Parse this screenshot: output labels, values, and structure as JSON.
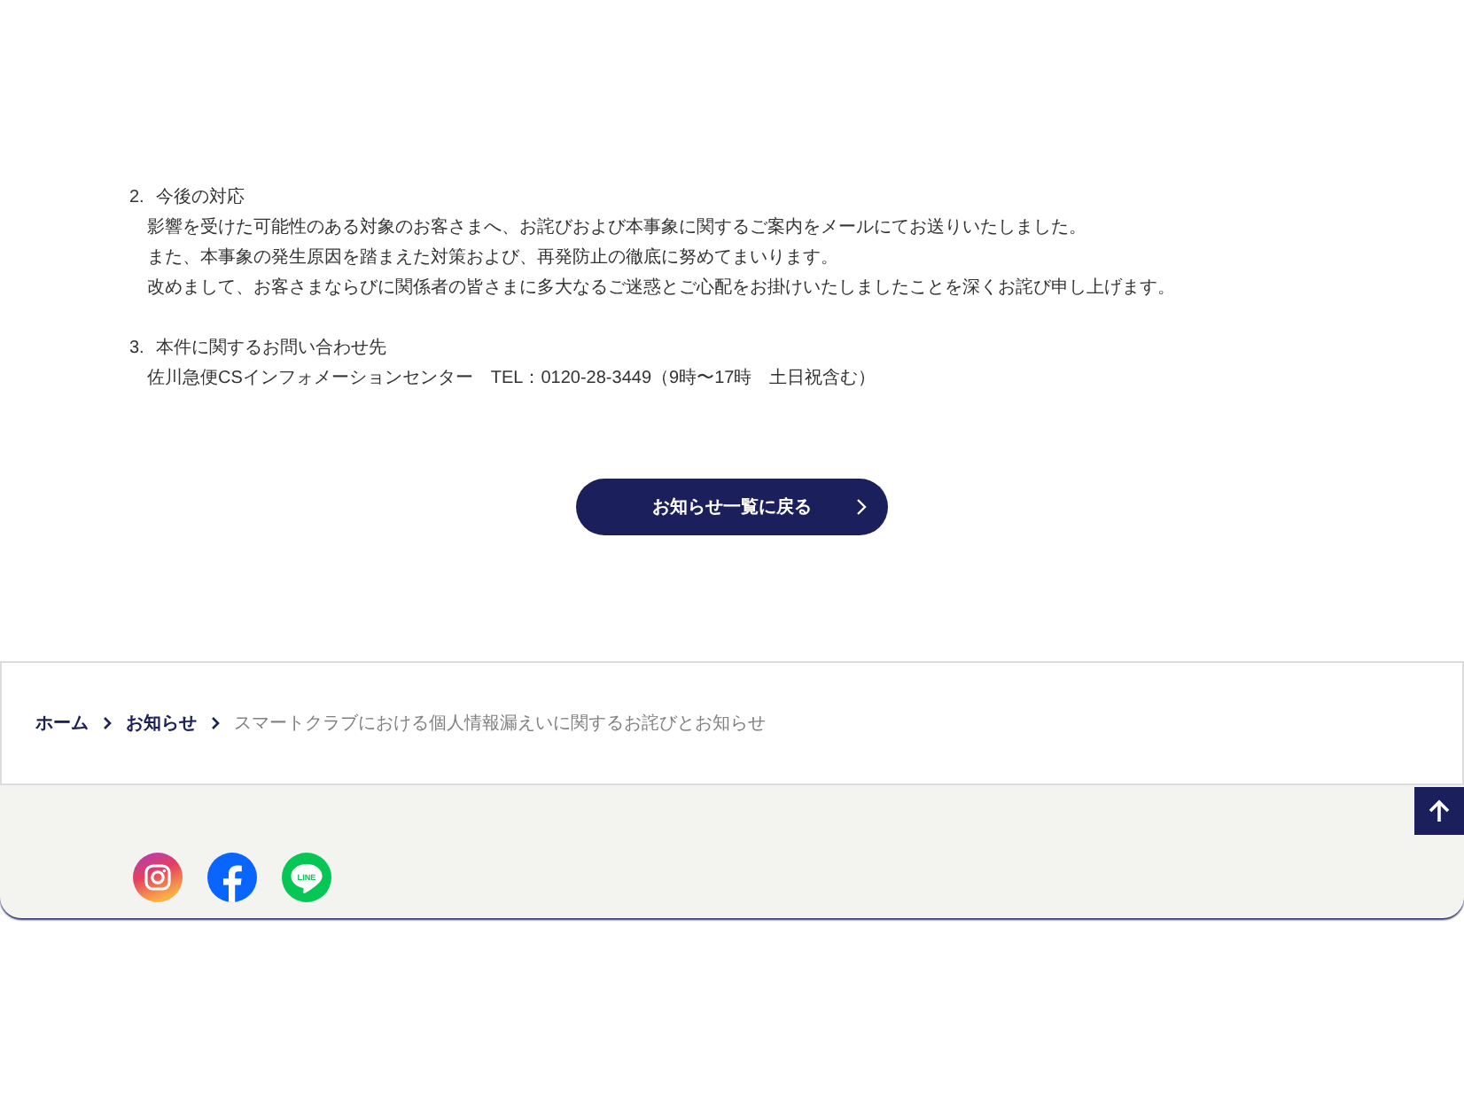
{
  "sections": [
    {
      "number": "2.",
      "heading": "今後の対応",
      "lines": [
        "影響を受けた可能性のある対象のお客さまへ、お詫びおよび本事象に関するご案内をメールにてお送りいたしました。",
        "また、本事象の発生原因を踏まえた対策および、再発防止の徹底に努めてまいります。",
        "改めまして、お客さまならびに関係者の皆さまに多大なるご迷惑とご心配をお掛けいたしましたことを深くお詫び申し上げます。"
      ]
    },
    {
      "number": "3.",
      "heading": "本件に関するお問い合わせ先",
      "lines": [
        "佐川急便CSインフォメーションセンター　TEL：0120-28-3449（9時〜17時　土日祝含む）"
      ]
    }
  ],
  "back_button": {
    "label": "お知らせ一覧に戻る"
  },
  "breadcrumb": [
    {
      "label": "ホーム",
      "current": false
    },
    {
      "label": "お知らせ",
      "current": false
    },
    {
      "label": "スマートクラブにおける個人情報漏えいに関するお詫びとお知らせ",
      "current": true
    }
  ],
  "footer": {
    "social_links": [
      {
        "kind": "instagram"
      },
      {
        "kind": "facebook"
      },
      {
        "kind": "line",
        "label": "LINE"
      }
    ],
    "page_top_button": true
  }
}
